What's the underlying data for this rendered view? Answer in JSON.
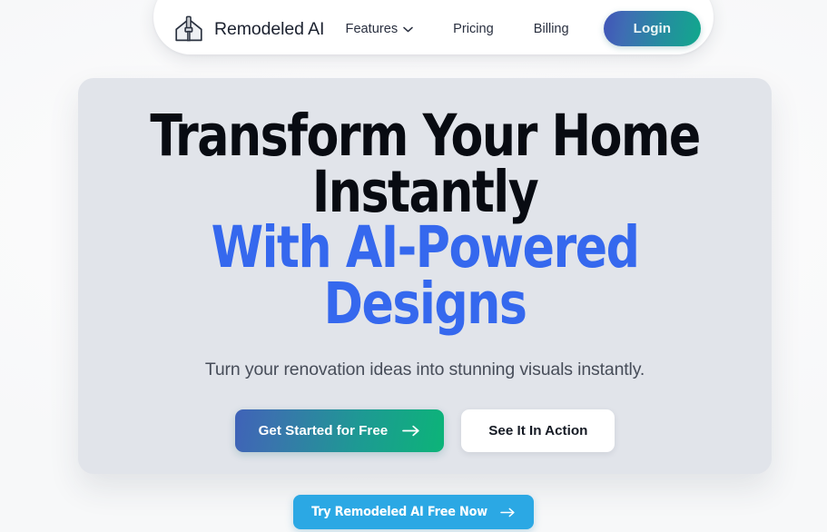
{
  "page": {
    "background_color": "#fbfbfc"
  },
  "navbar": {
    "brand": {
      "name": "Remodeled AI",
      "logo_icon": "house-paintbrush-icon"
    },
    "links": [
      {
        "label": "Features",
        "icon": "chevron-down-icon",
        "has_dropdown": true
      },
      {
        "label": "Pricing",
        "has_dropdown": false
      },
      {
        "label": "Billing",
        "has_dropdown": false
      }
    ],
    "login": {
      "label": "Login",
      "gradient_from": "#4154b8",
      "gradient_to": "#11a88c"
    }
  },
  "hero": {
    "background_color": "#e1e4ea",
    "headline": {
      "line1": "Transform Your Home",
      "line2": "Instantly",
      "line3": "With AI-Powered",
      "line4": "Designs",
      "plain_color": "#080b12",
      "accent_color": "#3568ee"
    },
    "subtitle": "Turn your renovation ideas into stunning visuals instantly.",
    "primary_cta": {
      "label": "Get Started for Free",
      "icon": "arrow-right-icon",
      "gradient_from": "#3f62b8",
      "gradient_to": "#0cb478"
    },
    "secondary_cta": {
      "label": "See It In Action",
      "background_color": "#ffffff"
    }
  },
  "bottom_cta": {
    "label": "Try Remodeled AI Free Now",
    "icon": "arrow-right-icon",
    "background_color": "#2ba8e4"
  }
}
